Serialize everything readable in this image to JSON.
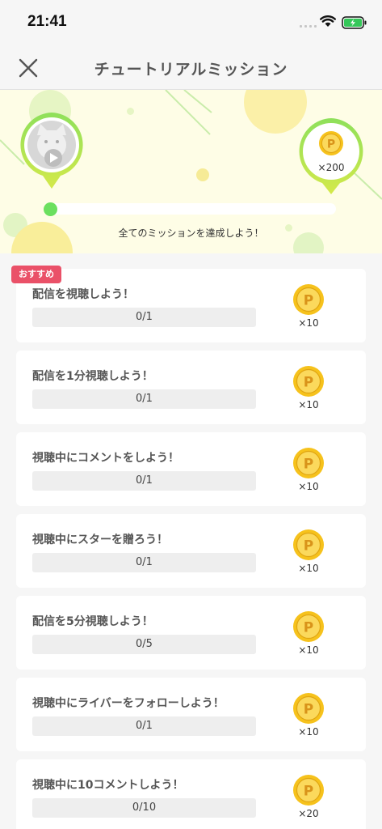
{
  "status_bar": {
    "time": "21:41"
  },
  "header": {
    "title": "チュートリアルミッション",
    "close_icon": "close-icon"
  },
  "banner": {
    "reward": "×200",
    "progress_fraction": 0,
    "message": "全てのミッションを達成しよう！"
  },
  "badge": {
    "label": "おすすめ"
  },
  "missions": [
    {
      "title": "配信を視聴しよう！",
      "progress": "0/1",
      "reward": "×10"
    },
    {
      "title": "配信を1分視聴しよう！",
      "progress": "0/1",
      "reward": "×10"
    },
    {
      "title": "視聴中にコメントをしよう！",
      "progress": "0/1",
      "reward": "×10"
    },
    {
      "title": "視聴中にスターを贈ろう！",
      "progress": "0/1",
      "reward": "×10"
    },
    {
      "title": "配信を5分視聴しよう！",
      "progress": "0/5",
      "reward": "×10"
    },
    {
      "title": "視聴中にライバーをフォローしよう！",
      "progress": "0/1",
      "reward": "×10"
    },
    {
      "title": "視聴中に10コメントしよう！",
      "progress": "0/10",
      "reward": "×20"
    }
  ],
  "colors": {
    "accent_green": "#7dd85a",
    "coin_gold": "#f6c21c",
    "badge_red": "#ea5168"
  }
}
